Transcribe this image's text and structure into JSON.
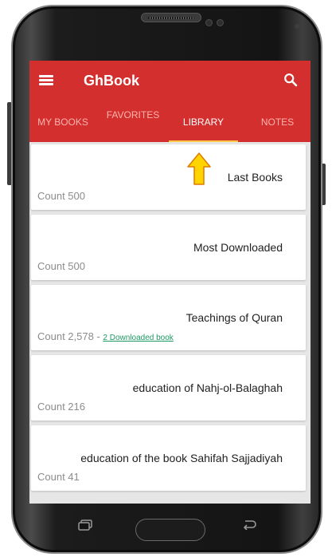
{
  "app": {
    "title": "GhBook"
  },
  "tabs": [
    {
      "label": "MY BOOKS"
    },
    {
      "label": "FAVORITES"
    },
    {
      "label": "LIBRARY",
      "selected": true
    },
    {
      "label": "NOTES"
    }
  ],
  "library_items": [
    {
      "title": "Last Books",
      "count": "Count 500"
    },
    {
      "title": "Most Downloaded",
      "count": "Count 500"
    },
    {
      "title": "Teachings of Quran",
      "count": "Count 2,578 - ",
      "downloaded": "2 Downloaded book"
    },
    {
      "title": "education of Nahj-ol-Balaghah",
      "count": "Count 216"
    },
    {
      "title": "education of the book Sahifah Sajjadiyah",
      "count": "Count 41"
    }
  ],
  "colors": {
    "appbar": "#d32f2f",
    "tab_indicator": "#ffc94a",
    "inactive_tab_text": "#ffb3ad",
    "download_link": "#1e9a63",
    "arrow_fill": "#ffd400"
  },
  "icons": {
    "menu": "menu-icon",
    "search": "search-icon",
    "arrow": "up-arrow-icon",
    "recent_apps": "recent-apps-icon",
    "back": "back-icon"
  }
}
